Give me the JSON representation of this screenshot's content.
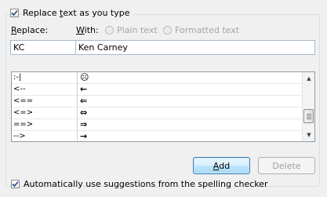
{
  "replace_as_you_type": {
    "label_before": "Replace ",
    "label_mnemonic": "t",
    "label_after": "ext as you type",
    "checked": true
  },
  "replace_label": {
    "mnemonic": "R",
    "rest": "eplace:"
  },
  "with_label": {
    "mnemonic": "W",
    "rest": "ith:"
  },
  "plain_text_label": "Plain text",
  "formatted_text_label": "Formatted text",
  "replace_value": "KC",
  "with_value": "Ken Carney",
  "entries": [
    {
      "replace": ":-|",
      "with": "☹"
    },
    {
      "replace": "<--",
      "with": "←"
    },
    {
      "replace": "<==",
      "with": "⇐"
    },
    {
      "replace": "<=>",
      "with": "⇔"
    },
    {
      "replace": "==>",
      "with": "⇒"
    },
    {
      "replace": "-->",
      "with": "→"
    }
  ],
  "add_button": {
    "mnemonic": "A",
    "rest": "dd"
  },
  "delete_button": "Delete",
  "spelling_suggestions": {
    "label": "Automatically use suggestions from the spelling checker",
    "checked": true
  }
}
